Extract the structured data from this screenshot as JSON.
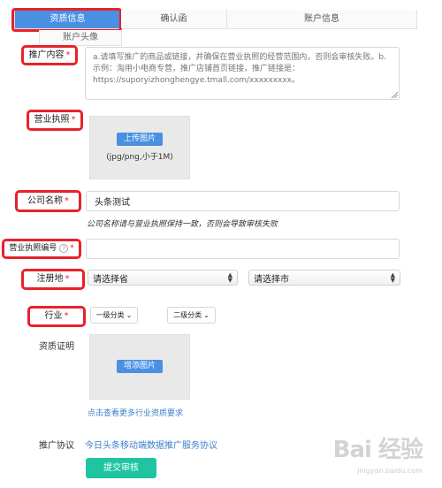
{
  "tabs": [
    {
      "label": "资质信息",
      "active": true
    },
    {
      "label": "确认函",
      "active": false
    },
    {
      "label": "账户信息",
      "active": false
    }
  ],
  "subtab": "账户头像",
  "form": {
    "promo_content": {
      "label": "推广内容",
      "placeholder": "a.请填写推广的商品或链接，并确保在营业执照的经营范围内，否则会审核失败。b.示例：淘用小电商专营，推广店铺首页链接，推广链接是：https://suporyizhonghengye.tmall.com/xxxxxxxxx。"
    },
    "license": {
      "label": "营业执照",
      "upload_button": "上传图片",
      "hint": "(jpg/png,小于1M)"
    },
    "company_name": {
      "label": "公司名称",
      "value": "头条测试",
      "note": "公司名称请与营业执照保持一致，否则会导致审核失败"
    },
    "license_number": {
      "label": "营业执照编号",
      "help_icon": "?",
      "value": ""
    },
    "registered_place": {
      "label": "注册地",
      "province": "请选择省",
      "city": "请选择市"
    },
    "industry": {
      "label": "行业",
      "level1": "一级分类",
      "level2": "二级分类"
    },
    "qualification": {
      "label": "资质证明",
      "upload_button": "增添图片",
      "link": "点击查看更多行业资质要求"
    },
    "agreement": {
      "label": "推广协议",
      "link": "今日头条移动端数据推广服务协议"
    },
    "submit_label": "提交审核",
    "required_mark": "*"
  },
  "watermark": {
    "logo": "Bai 经验",
    "url": "jingyan.baidu.com"
  },
  "colors": {
    "accent_blue": "#4a90e2",
    "annotation_red": "#e8212b",
    "submit_green": "#1fc4a1",
    "link_blue": "#3d7fc9"
  }
}
